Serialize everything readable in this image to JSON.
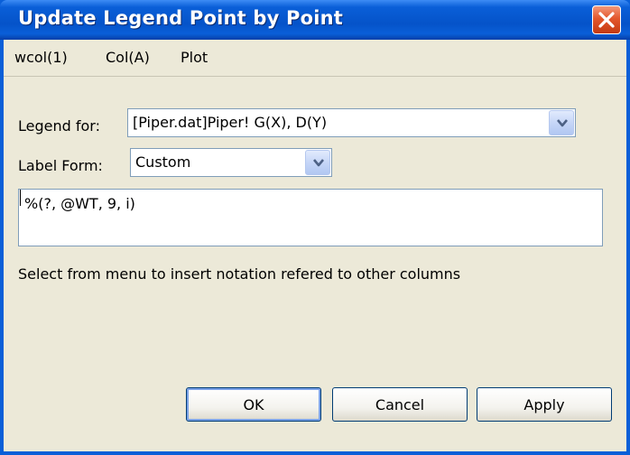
{
  "window": {
    "title": "Update Legend Point by Point",
    "close_icon": "close-icon"
  },
  "menu": {
    "items": [
      "wcol(1)",
      "Col(A)",
      "Plot"
    ]
  },
  "legend_for": {
    "label": "Legend for:",
    "value": "[Piper.dat]Piper! G(X), D(Y)"
  },
  "label_form": {
    "label": "Label Form:",
    "value": "Custom"
  },
  "expression": {
    "value": "%(?, @WT, 9, i)"
  },
  "hint": "Select from menu to insert notation refered to other columns",
  "buttons": {
    "ok": "OK",
    "cancel": "Cancel",
    "apply": "Apply"
  },
  "colors": {
    "titlebar": "#0a5fd8",
    "close_button": "#e3572c",
    "dialog_bg": "#ece9d8"
  }
}
